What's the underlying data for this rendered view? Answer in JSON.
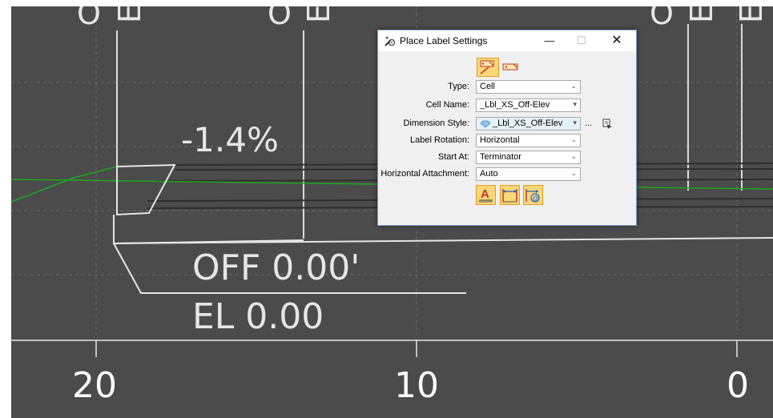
{
  "viewport": {
    "background": "#4b4b4b",
    "slope_label": "-1.4%",
    "offset_label": "OFF 0.00'",
    "elevation_label": "EL 0.00",
    "axis_labels": [
      "20",
      "10",
      "0"
    ],
    "top_marker_glyphs": [
      "O",
      "E",
      "O",
      "E",
      "O",
      "E",
      "E"
    ]
  },
  "dialog": {
    "title": "Place Label Settings",
    "title_icon": "wrench-gear-icon",
    "window_buttons": {
      "minimize": "—",
      "maximize": "☐",
      "close": "✕"
    },
    "mode_buttons": [
      {
        "name": "label-mode-icon",
        "selected": true
      },
      {
        "name": "cell-mode-icon",
        "selected": false
      }
    ],
    "fields": {
      "type": {
        "label": "Type:",
        "value": "Cell"
      },
      "cell_name": {
        "label": "Cell Name:",
        "value": "_Lbl_XS_Off-Elev"
      },
      "dimension_style": {
        "label": "Dimension Style:",
        "value": "_Lbl_XS_Off-Elev"
      },
      "label_rotation": {
        "label": "Label Rotation:",
        "value": "Horizontal"
      },
      "start_at": {
        "label": "Start At:",
        "value": "Terminator"
      },
      "horizontal_attachment": {
        "label": "Horizontal Attachment:",
        "value": "Auto"
      }
    },
    "ellipsis": "...",
    "bottom_buttons": [
      "text-style-icon",
      "leader-icon",
      "at-symbol-icon"
    ],
    "colors": {
      "accent_fill": "#fbd877",
      "accent_border": "#e39b2c",
      "title_bar": "#ffffff"
    }
  }
}
